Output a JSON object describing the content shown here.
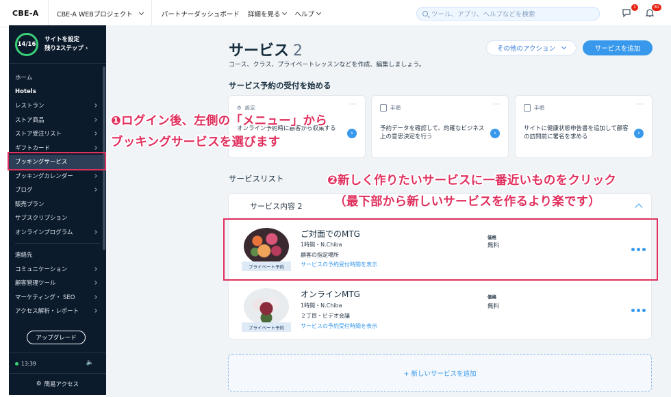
{
  "topbar": {
    "logo": "CBE-A",
    "site_name": "CBE-A WEBプロジェクト",
    "nav": [
      "パートナーダッシュボード",
      "詳細を見る",
      "ヘルプ"
    ],
    "search_placeholder": "ツール、アプリ、ヘルプなどを検索",
    "chat_badge": "1",
    "notif_badge": "81"
  },
  "sidebar": {
    "progress": "14/16",
    "setup_title": "サイトを設定",
    "setup_sub": "残り2ステップ ›",
    "items": [
      {
        "label": "ホーム"
      },
      {
        "label": "Hotels"
      },
      {
        "label": "レストラン"
      },
      {
        "label": "ストア商品"
      },
      {
        "label": "ストア受注リスト"
      },
      {
        "label": "ギフトカード"
      },
      {
        "label": "ブッキングサービス"
      },
      {
        "label": "ブッキングカレンダー"
      },
      {
        "label": "ブログ"
      },
      {
        "label": "販売プラン"
      },
      {
        "label": "サブスクリプション"
      },
      {
        "label": "オンラインプログラム"
      },
      {
        "label": "連絡先"
      },
      {
        "label": "コミュニケーション"
      },
      {
        "label": "顧客管理ツール"
      },
      {
        "label": "マーケティング・ SEO"
      },
      {
        "label": "アクセス解析・レポート"
      }
    ],
    "upgrade": "アップグレード",
    "time": "13:39",
    "quick_access": "簡易アクセス"
  },
  "main": {
    "title": "サービス",
    "count": "2",
    "subtitle": "コース、クラス、プライベートレッスンなどを作成、編集しましょう。",
    "more_actions": "その他のアクション",
    "add_service": "サービスを追加",
    "start_heading": "サービス予約の受付を始める",
    "cards": [
      {
        "type": "設定",
        "text": "オンライン予約時に顧客から収集する"
      },
      {
        "type": "手順",
        "text": "予約データを確認して、的確なビジネス上の意思決定を行う"
      },
      {
        "type": "手順",
        "text": "サイトに健康状態申告書を追加して顧客の訪問前に署名を求める"
      }
    ],
    "list_heading": "サービスリスト",
    "group_title": "サービス内容 2",
    "services": [
      {
        "name": "ご対面でのMTG",
        "duration": "1時間・N.Chiba",
        "location": "顧客の指定場所",
        "link": "サービスの予約受付時間を表示",
        "price_label": "価格",
        "price": "無料",
        "tag": "プライベート予約"
      },
      {
        "name": "オンラインMTG",
        "duration": "1時間・N.Chiba",
        "location": "２丁目・ビデオ会議",
        "link": "サービスの予約受付時間を表示",
        "price_label": "価格",
        "price": "無料",
        "tag": "プライベート予約"
      }
    ],
    "add_new": "+ 新しいサービスを追加"
  },
  "annotations": {
    "a1_line1": "❶ログイン後、左側の「メニュー」から",
    "a1_line2": "ブッキングサービスを選びます",
    "a2_line1": "❷新しく作りたいサービスに一番近いものをクリック",
    "a2_line2": "（最下部から新しいサービスを作るより楽です）"
  },
  "colors": {
    "accent": "#3899ec",
    "sidebar_bg": "#0c1b2c",
    "annotation": "#e0305e"
  }
}
